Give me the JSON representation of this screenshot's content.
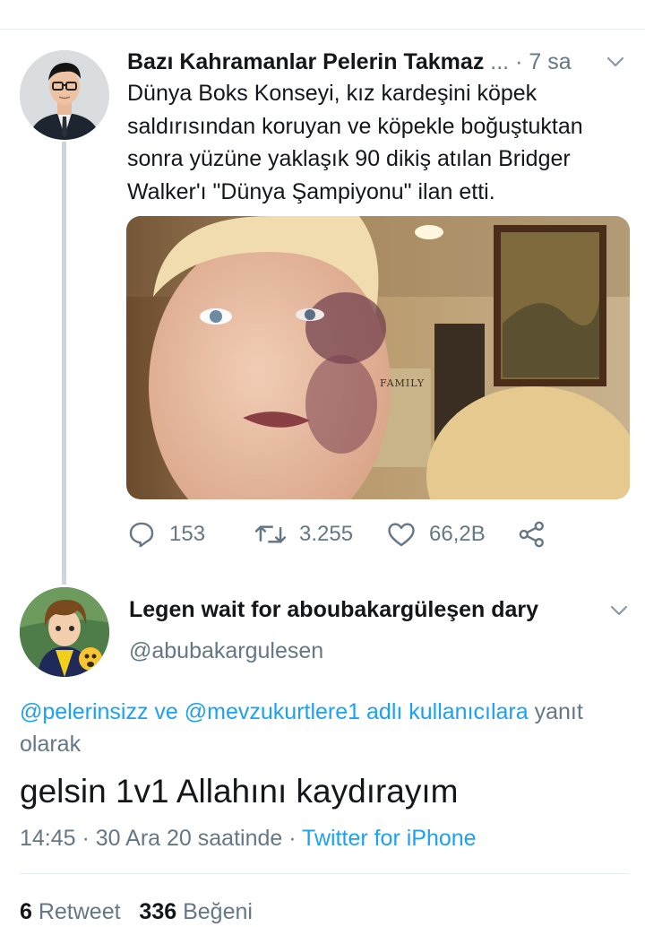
{
  "tweet": {
    "author_name": "Bazı Kahramanlar Pelerin Takmaz",
    "ellipsis": "...",
    "time": "· 7 sa",
    "text": "Dünya Boks Konseyi, kız kardeşini köpek saldırısından koruyan ve köpekle boğuştuktan sonra yüzüne yaklaşık 90 dikiş atılan Bridger Walker'ı \"Dünya Şampiyonu\" ilan etti.",
    "photo_caption": "FAMILY",
    "replies": "153",
    "retweets": "3.255",
    "likes": "66,2B"
  },
  "reply": {
    "author_name": "Legen wait for aboubakargüleşen dary",
    "handle": "@abubakargulesen",
    "reply_mention_1": "@pelerinsizz",
    "reply_and": " ve ",
    "reply_mention_2": "@mevzukurtlere1",
    "reply_link_rest": " adlı kullanıcılara",
    "reply_suffix": " yanıt olarak",
    "text": "gelsin 1v1 Allahını kaydırayım",
    "time": "14:45 · 30 Ara 20 saatinde · ",
    "source": "Twitter for iPhone",
    "retweet_count": "6",
    "retweet_label": " Retweet",
    "like_count": "336",
    "like_label": " Beğeni"
  },
  "colors": {
    "accent": "#1da1f2",
    "muted": "#657786",
    "text": "#14171a"
  }
}
